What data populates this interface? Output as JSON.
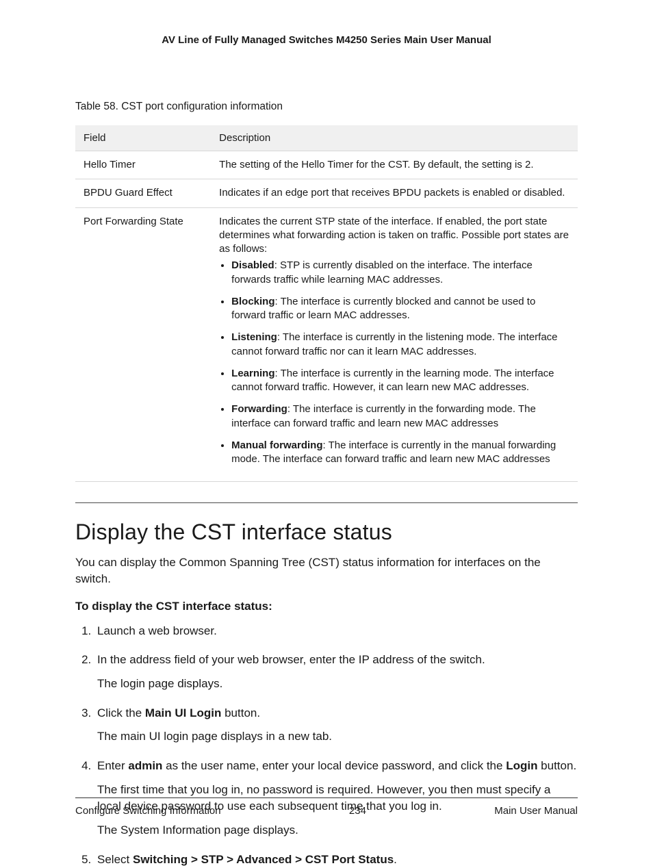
{
  "header": {
    "title": "AV Line of Fully Managed Switches M4250 Series Main User Manual"
  },
  "table": {
    "caption": "Table 58. CST port configuration information",
    "head": {
      "field": "Field",
      "desc": "Description"
    },
    "rows": {
      "hello": {
        "field": "Hello Timer",
        "desc": "The setting of the Hello Timer for the CST. By default, the setting is 2."
      },
      "bpdu": {
        "field": "BPDU Guard Effect",
        "desc": "Indicates if an edge port that receives BPDU packets is enabled or disabled."
      },
      "pfs": {
        "field": "Port Forwarding State",
        "intro": "Indicates the current STP state of the interface. If enabled, the port state determines what forwarding action is taken on traffic. Possible port states are as follows:",
        "states": {
          "disabled": {
            "name": "Disabled",
            "text": ": STP is currently disabled on the interface. The interface forwards traffic while learning MAC addresses."
          },
          "blocking": {
            "name": "Blocking",
            "text": ": The interface is currently blocked and cannot be used to forward traffic or learn MAC addresses."
          },
          "listening": {
            "name": "Listening",
            "text": ": The interface is currently in the listening mode. The interface cannot forward traffic nor can it learn MAC addresses."
          },
          "learning": {
            "name": "Learning",
            "text": ": The interface is currently in the learning mode. The interface cannot forward traffic. However, it can learn new MAC addresses."
          },
          "forwarding": {
            "name": "Forwarding",
            "text": ": The interface is currently in the forwarding mode. The interface can forward traffic and learn new MAC addresses"
          },
          "manual": {
            "name": "Manual forwarding",
            "text": ": The interface is currently in the manual forwarding mode. The interface can forward traffic and learn new MAC addresses"
          }
        }
      }
    }
  },
  "section": {
    "title": "Display the CST interface status",
    "intro": "You can display the Common Spanning Tree (CST) status information for interfaces on the switch.",
    "proc_heading": "To display the CST interface status:"
  },
  "steps": {
    "s1": {
      "main": "Launch a web browser."
    },
    "s2": {
      "main": "In the address field of your web browser, enter the IP address of the switch.",
      "sub1": "The login page displays."
    },
    "s3": {
      "pre": "Click the ",
      "bold": "Main UI Login",
      "post": " button.",
      "sub1": "The main UI login page displays in a new tab."
    },
    "s4": {
      "pre": "Enter ",
      "bold1": "admin",
      "mid": " as the user name, enter your local device password, and click the ",
      "bold2": "Login",
      "post": " button.",
      "sub1": "The first time that you log in, no password is required. However, you then must specify a local device password to use each subsequent time that you log in.",
      "sub2": "The System Information page displays."
    },
    "s5": {
      "pre": "Select ",
      "bold": "Switching > STP > Advanced > CST Port Status",
      "post": "."
    }
  },
  "footer": {
    "left": "Configure Switching Information",
    "center": "234",
    "right": "Main User Manual"
  }
}
